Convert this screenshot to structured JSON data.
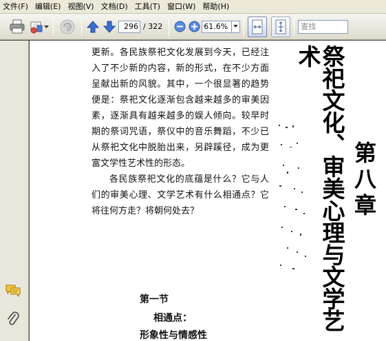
{
  "menu": {
    "items": [
      "文件(F)",
      "编辑(E)",
      "视图(V)",
      "文档(D)",
      "工具(T)",
      "窗口(W)",
      "帮助(H)"
    ]
  },
  "toolbar": {
    "icons": [
      "printer-icon",
      "email-icon",
      "chevron-down-icon",
      "review-icon",
      "previous-page-icon",
      "next-page-icon",
      "zoom-out-icon",
      "zoom-in-icon",
      "fit-width-icon",
      "fit-page-icon"
    ],
    "page_current": "296",
    "page_total": "/ 322",
    "zoom": "61.6%",
    "search_placeholder": "查找"
  },
  "navpane": {
    "icons": [
      "comments-icon",
      "attachments-icon"
    ]
  },
  "page": {
    "body_paragraph_1": "更新。各民族祭祀文化发展到今天，已经注入了不少新的内容，新的形式，在不少方面呈献出新的风貌。其中，一个很显著的趋势便是：祭祀文化逐渐包含越来越多的审美因素，逐渐具有越来越多的娱人倾向。较早时期的祭词咒语，祭仪中的音乐舞蹈，不少已从祭祀文化中脱胎出来，另辟蹊径，成为更富文学性艺术性的形态。",
    "body_paragraph_2": "各民族祭祀文化的底蕴是什么？它与人们的审美心理、文学艺术有什么相通点？它将往何方走？将朝何处去？",
    "section_heading": "第一节",
    "section_subheading": "相通点：",
    "section_subheading_2": "形象性与情感性",
    "chapter_title": "祭祀文化、审美心理与文学艺术",
    "chapter_number": "第八章"
  },
  "colors": {
    "menu_bg": "#ece9d8",
    "toolbar_bg": "#e4e2d6",
    "workspace_bg": "#4d4d4d",
    "page_bg": "#ffffff",
    "accent_blue": "#3a6fd0"
  }
}
